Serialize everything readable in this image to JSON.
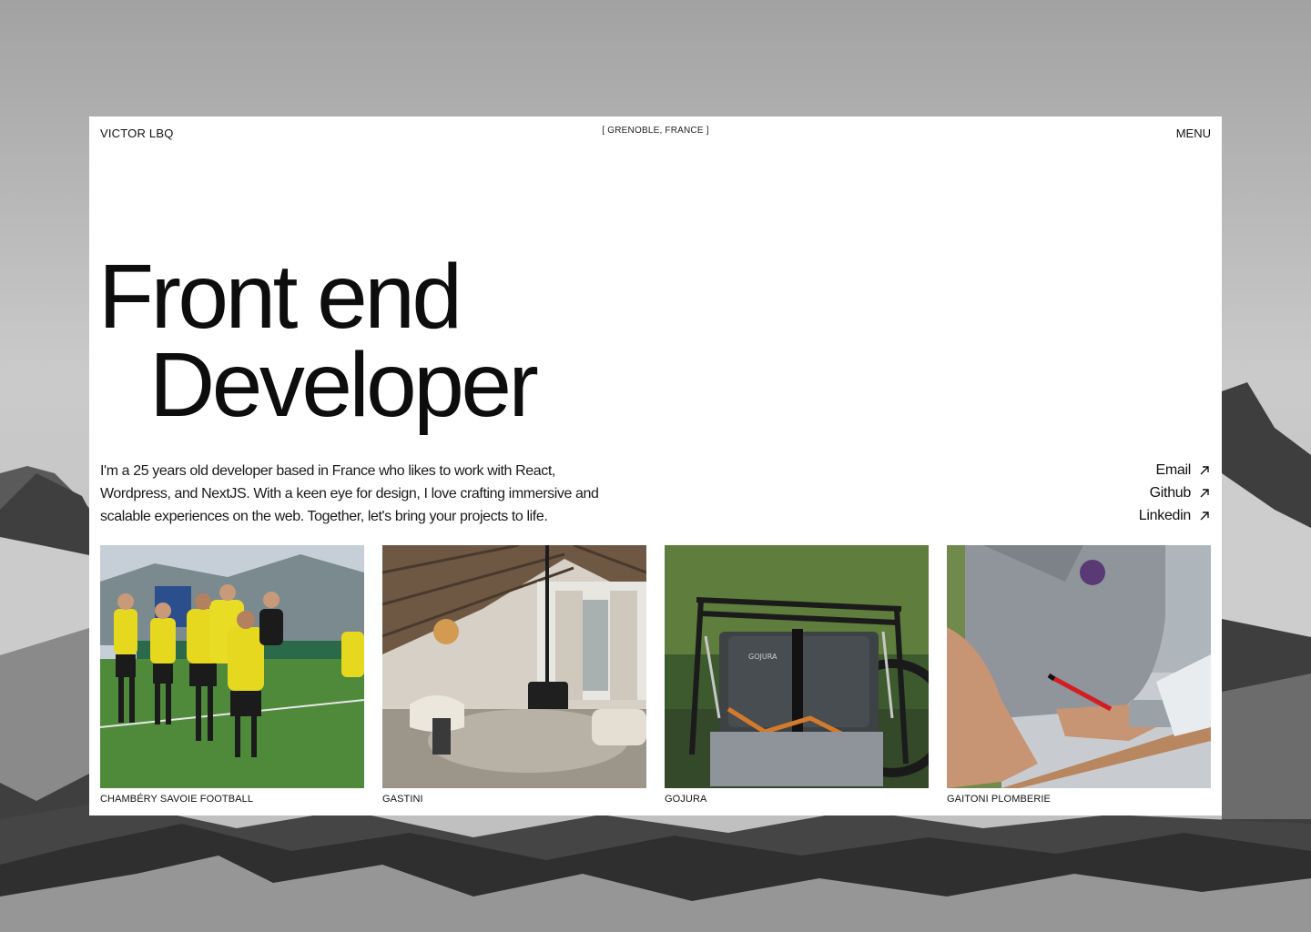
{
  "header": {
    "brand": "VICTOR LBQ",
    "location": "[ GRENOBLE, FRANCE ]",
    "menu_label": "MENU"
  },
  "hero": {
    "line1": "Front end",
    "line2": "Developer"
  },
  "intro": {
    "text": "I'm a 25 years old developer based in France who likes to work with React, Wordpress, and NextJS. With a keen eye for design, I love crafting immersive and scalable experiences on the web. Together, let's bring your projects to life."
  },
  "links": [
    {
      "label": "Email",
      "icon": "arrow-up-right-icon"
    },
    {
      "label": "Github",
      "icon": "arrow-up-right-icon"
    },
    {
      "label": "Linkedin",
      "icon": "arrow-up-right-icon"
    }
  ],
  "projects": [
    {
      "title": "CHAMBÉRY SAVOIE FOOTBALL",
      "image": "football-team-celebration-photo"
    },
    {
      "title": "GASTINI",
      "image": "chalet-living-room-photo"
    },
    {
      "title": "GOJURA",
      "image": "bike-pannier-bag-photo"
    },
    {
      "title": "GAITONI PLOMBERIE",
      "image": "plumber-measuring-pipe-photo"
    }
  ],
  "colors": {
    "card_background": "#ffffff",
    "text": "#111111",
    "background_mountain": "#9e9e9e"
  }
}
